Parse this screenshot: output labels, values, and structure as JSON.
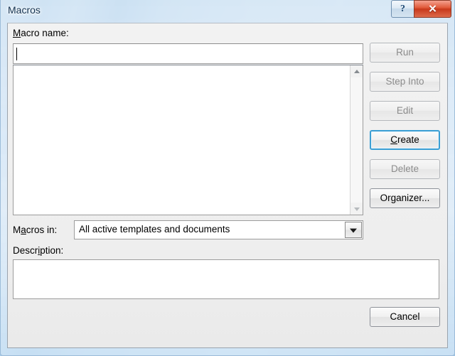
{
  "window": {
    "title": "Macros",
    "caption_buttons": [
      {
        "name": "help",
        "glyph": "?"
      },
      {
        "name": "close",
        "glyph": "✕"
      }
    ]
  },
  "dialog": {
    "macro_name": {
      "label_prefix": "",
      "label_accel": "M",
      "label_suffix": "acro name:",
      "value": "",
      "placeholder": ""
    },
    "macro_list": {
      "items": [],
      "scrollbar": {
        "up_arrow": "▲",
        "down_arrow": "▼"
      }
    },
    "macros_in": {
      "label_prefix": "M",
      "label_accel": "a",
      "label_suffix": "cros in:",
      "selected": "All active templates and documents",
      "options": [
        "All active templates and documents"
      ],
      "dropdown_icon": "chevron-down-icon"
    },
    "description": {
      "label_prefix": "Descr",
      "label_accel": "i",
      "label_suffix": "ption:",
      "value": ""
    },
    "buttons": [
      {
        "id": "run",
        "prefix": "",
        "accel": "",
        "suffix": "Run",
        "disabled": true,
        "focused": false
      },
      {
        "id": "step-into",
        "prefix": "",
        "accel": "",
        "suffix": "Step Into",
        "disabled": true,
        "focused": false
      },
      {
        "id": "edit",
        "prefix": "",
        "accel": "",
        "suffix": "Edit",
        "disabled": true,
        "focused": false
      },
      {
        "id": "create",
        "prefix": "",
        "accel": "C",
        "suffix": "reate",
        "disabled": false,
        "focused": true
      },
      {
        "id": "delete",
        "prefix": "",
        "accel": "",
        "suffix": "Delete",
        "disabled": true,
        "focused": false
      },
      {
        "id": "organizer",
        "prefix": "Or",
        "accel": "g",
        "suffix": "anizer...",
        "disabled": false,
        "focused": false
      },
      {
        "id": "cancel",
        "prefix": "",
        "accel": "",
        "suffix": "Cancel",
        "disabled": false,
        "focused": false
      }
    ]
  },
  "labels": {
    "macro_name": "Macro name:",
    "macros_in": "Macros in:",
    "description": "Description:",
    "run": "Run",
    "step_into": "Step Into",
    "edit": "Edit",
    "create": "Create",
    "delete": "Delete",
    "organizer": "Organizer...",
    "cancel": "Cancel"
  },
  "colors": {
    "focus_ring": "#3c9fd4",
    "close_button": "#c8391c",
    "dialog_background": "#f0f0f0",
    "field_background": "#ffffff",
    "disabled_text": "#8c8c8c",
    "title_text": "#12314f"
  }
}
